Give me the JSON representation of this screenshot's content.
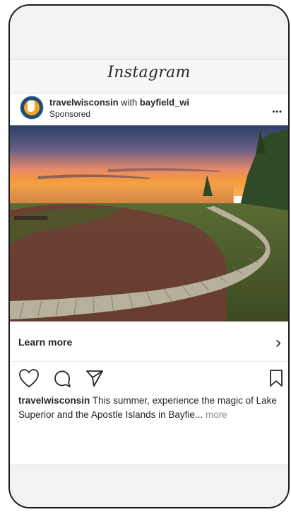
{
  "app": {
    "brand": "Instagram"
  },
  "post": {
    "username": "travelwisconsin",
    "with_text": "with",
    "collaborator": "bayfield_wi",
    "sponsored_label": "Sponsored",
    "more_glyph": "•••",
    "cta_label": "Learn more",
    "cta_chevron": "›",
    "caption_text": "This summer, experience the magic of Lake Superior and the Apostle Islands in Bayfie...",
    "caption_more": "more"
  },
  "icons": {
    "like": "heart-icon",
    "comment": "comment-icon",
    "share": "send-icon",
    "save": "bookmark-icon",
    "more": "more-options-icon"
  },
  "colors": {
    "text": "#262626",
    "muted": "#8e8e8e",
    "avatar_blue": "#1d4d7a",
    "avatar_orange": "#f3a51c"
  }
}
